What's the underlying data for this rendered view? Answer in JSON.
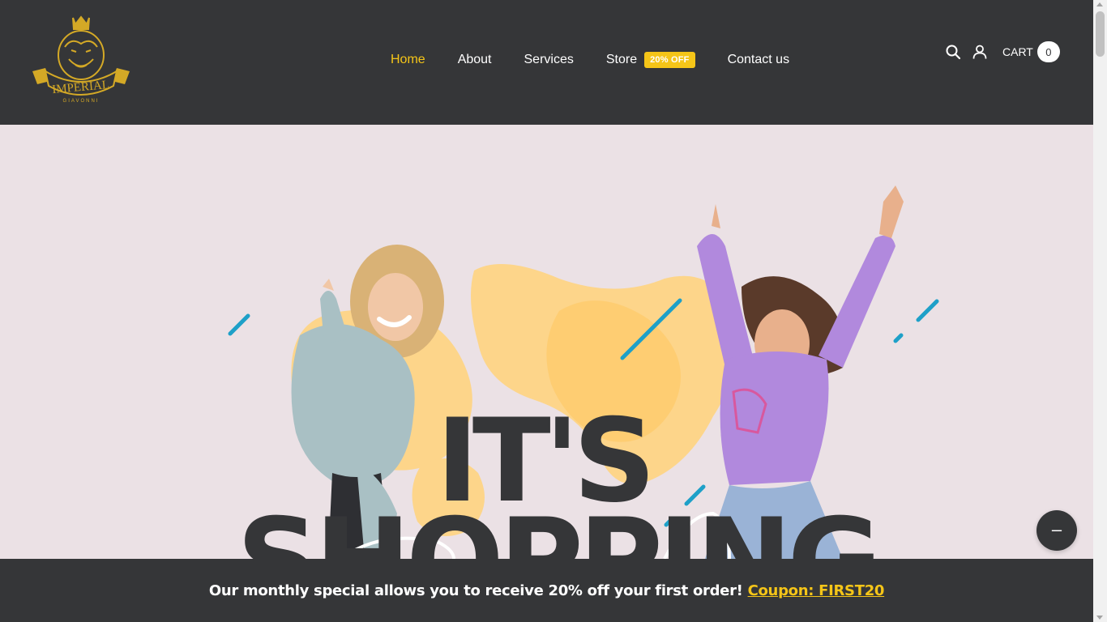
{
  "brand": {
    "logo_name": "IMPERIAL",
    "logo_sub": "GIAVONNI",
    "logo_color": "#d4a926"
  },
  "nav": {
    "items": [
      {
        "label": "Home",
        "active": true
      },
      {
        "label": "About"
      },
      {
        "label": "Services"
      },
      {
        "label": "Store",
        "badge": "20% OFF"
      },
      {
        "label": "Contact us"
      }
    ]
  },
  "header_icons": [
    "search-icon",
    "user-icon"
  ],
  "cart": {
    "label": "CART",
    "count": "0"
  },
  "hero": {
    "line1": "IT'S",
    "line2": "SHOPPING"
  },
  "floating_button": {
    "symbol": "–"
  },
  "promo": {
    "text": "Our monthly special allows you to receive 20% off your first order!",
    "link": "Coupon: FIRST20"
  },
  "colors": {
    "header_bg": "#353638",
    "accent": "#f5c518",
    "hero_bg": "#ebe1e5",
    "blob": "#fdd58a",
    "stripe": "#1ea0c8"
  }
}
